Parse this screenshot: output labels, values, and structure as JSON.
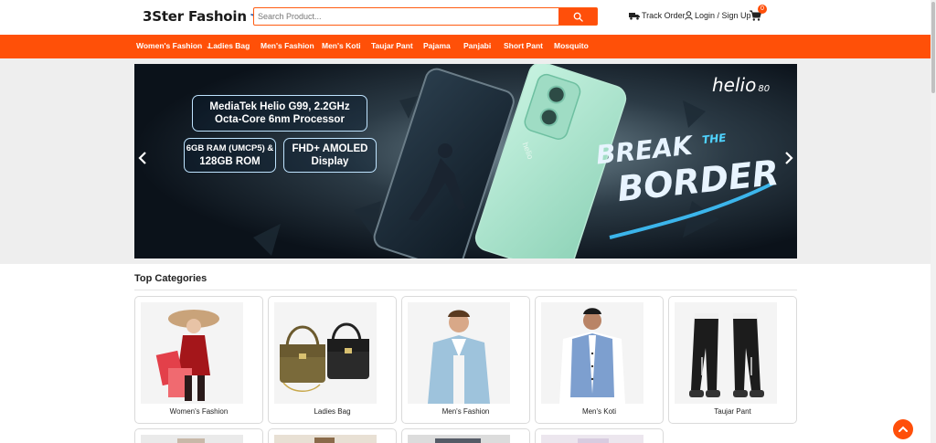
{
  "header": {
    "logo_text": "3Ster Fashoin",
    "search_placeholder": "Search Product...",
    "track_order": "Track Order",
    "login": "Login / Sign Up",
    "cart_count": "0"
  },
  "nav": {
    "items": [
      "Women's Fashion",
      "Ladies Bag",
      "Men's Fashion",
      "Men's Koti",
      "Taujar Pant",
      "Pajama",
      "Panjabi",
      "Short Pant",
      "Mosquito"
    ]
  },
  "banner": {
    "line1": "MediaTek Helio G99, 2.2GHz",
    "line2": "Octa-Core 6nm Processor",
    "ram_1": "6GB RAM (UMCP5) &",
    "ram_2": "128GB ROM",
    "display_1": "FHD+ AMOLED",
    "display_2": "Display",
    "brand": "helio",
    "brand_num": "80",
    "break": "BREAK",
    "the": "THE",
    "border": "BORDER",
    "phone_logo": "helio"
  },
  "categories": {
    "title": "Top Categories",
    "items": [
      "Women's Fashion",
      "Ladies Bag",
      "Men's Fashion",
      "Men's Koti",
      "Taujar Pant"
    ]
  },
  "colors": {
    "accent": "#ff5008",
    "nav_bg": "#ff5008",
    "banner_bg": "#0e1620"
  },
  "icons": {
    "search": "search-icon",
    "track": "truck-icon",
    "login": "user-icon",
    "cart": "cart-icon",
    "prev": "chevron-left-icon",
    "next": "chevron-right-icon",
    "top": "chevron-up-icon"
  }
}
